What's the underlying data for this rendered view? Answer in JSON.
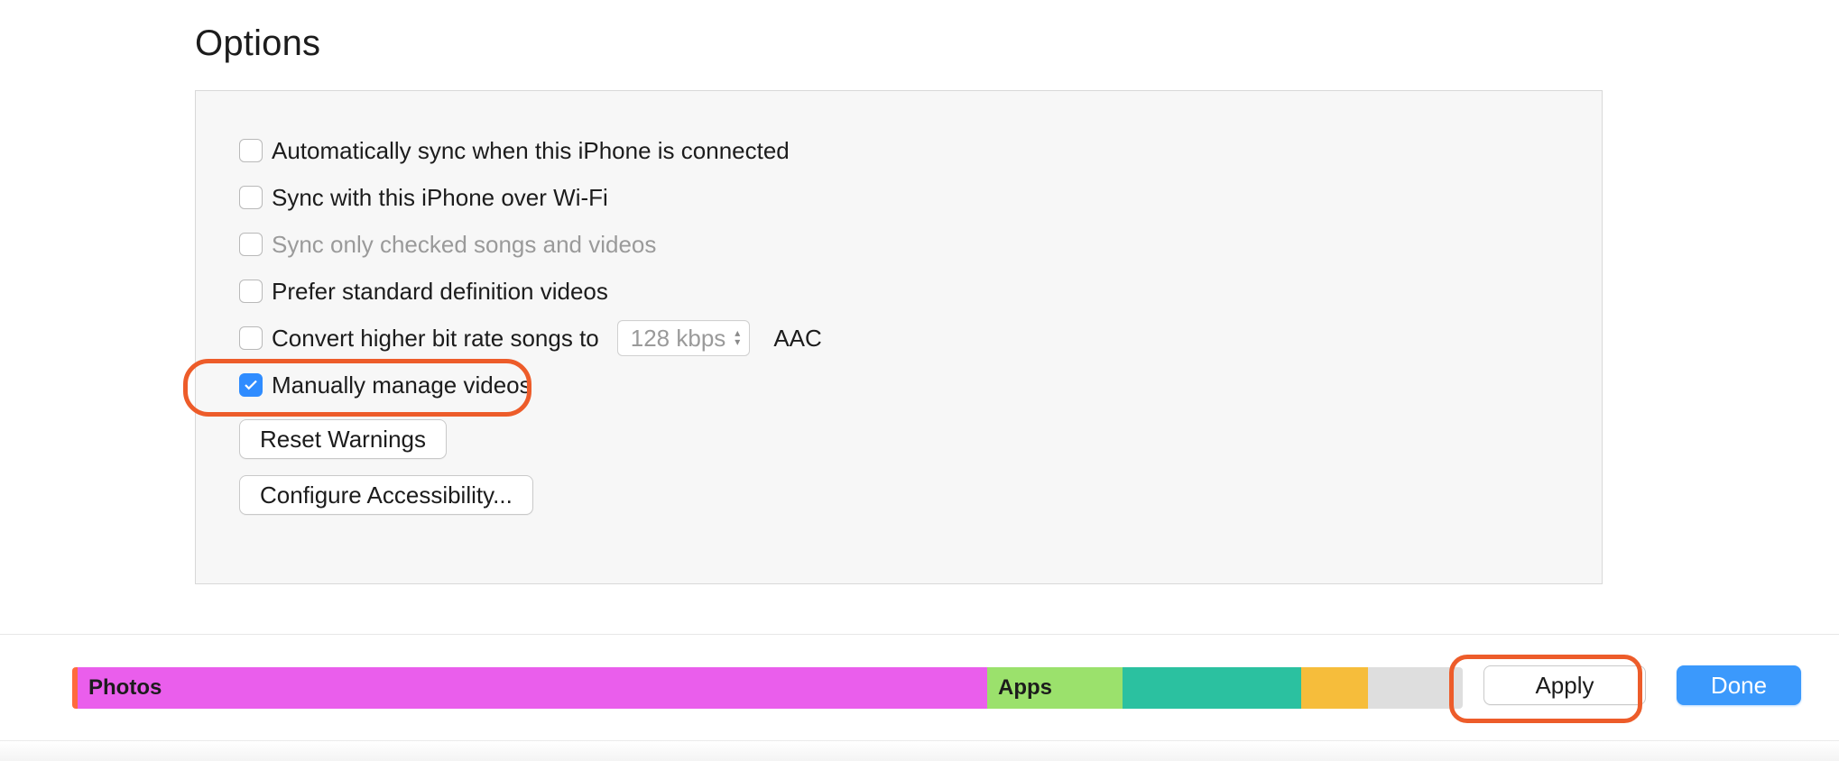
{
  "section_title": "Options",
  "options": {
    "auto_sync": {
      "label": "Automatically sync when this iPhone is connected",
      "checked": false,
      "disabled": false
    },
    "wifi_sync": {
      "label": "Sync with this iPhone over Wi-Fi",
      "checked": false,
      "disabled": false
    },
    "checked_only": {
      "label": "Sync only checked songs and videos",
      "checked": false,
      "disabled": true
    },
    "prefer_sd": {
      "label": "Prefer standard definition videos",
      "checked": false,
      "disabled": false
    },
    "convert_bitrate": {
      "label": "Convert higher bit rate songs to",
      "checked": false,
      "disabled": false,
      "bitrate_value": "128 kbps",
      "codec": "AAC"
    },
    "manual_manage": {
      "label": "Manually manage videos",
      "checked": true,
      "disabled": false
    }
  },
  "buttons": {
    "reset_warnings": "Reset Warnings",
    "configure_accessibility": "Configure Accessibility..."
  },
  "storage": {
    "segments": {
      "photos": {
        "label": "Photos"
      },
      "apps": {
        "label": "Apps"
      }
    }
  },
  "footer_buttons": {
    "apply": "Apply",
    "done": "Done"
  }
}
